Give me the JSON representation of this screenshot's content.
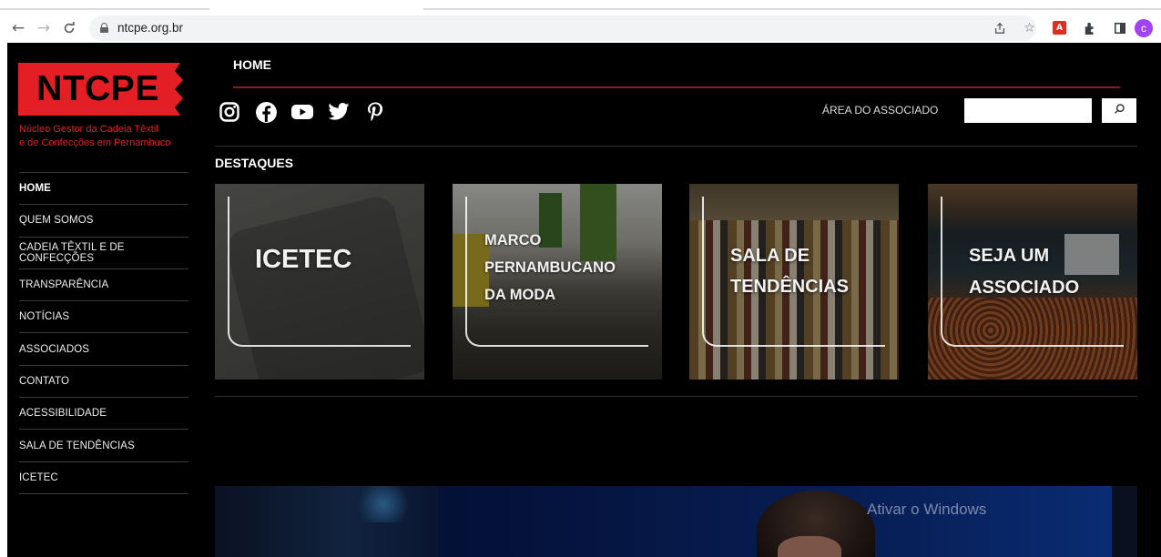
{
  "browser": {
    "url": "ntcpe.org.br"
  },
  "logo": {
    "text": "NTCPE",
    "tagline_line1": "Núcleo Gestor da Cadeia Têxtil",
    "tagline_line2": "e de Confecções em Pernambuco",
    "color": "#e31e24"
  },
  "sidebar": {
    "items": [
      {
        "label": "HOME"
      },
      {
        "label": "QUEM SOMOS"
      },
      {
        "label": "CADEIA TÊXTIL E DE CONFECÇÕES"
      },
      {
        "label": "TRANSPARÊNCIA"
      },
      {
        "label": "NOTÍCIAS"
      },
      {
        "label": "ASSOCIADOS"
      },
      {
        "label": "CONTATO"
      },
      {
        "label": "ACESSIBILIDADE"
      },
      {
        "label": "SALA DE TENDÊNCIAS"
      },
      {
        "label": "ICETEC"
      }
    ]
  },
  "header": {
    "home_label": "HOME",
    "area_label": "ÁREA DO ASSOCIADO",
    "search_value": ""
  },
  "social": [
    "instagram-icon",
    "facebook-icon",
    "youtube-icon",
    "twitter-icon",
    "pinterest-icon"
  ],
  "featured": {
    "title": "DESTAQUES",
    "cards": [
      {
        "line1": "ICETEC"
      },
      {
        "line1": "MARCO",
        "line2": "PERNAMBUCANO",
        "line3": "DA MODA"
      },
      {
        "line1": "SALA DE",
        "line2": "TENDÊNCIAS"
      },
      {
        "line1": "SEJA UM",
        "line2": "ASSOCIADO"
      }
    ]
  },
  "watermark": "Ativar o Windows"
}
